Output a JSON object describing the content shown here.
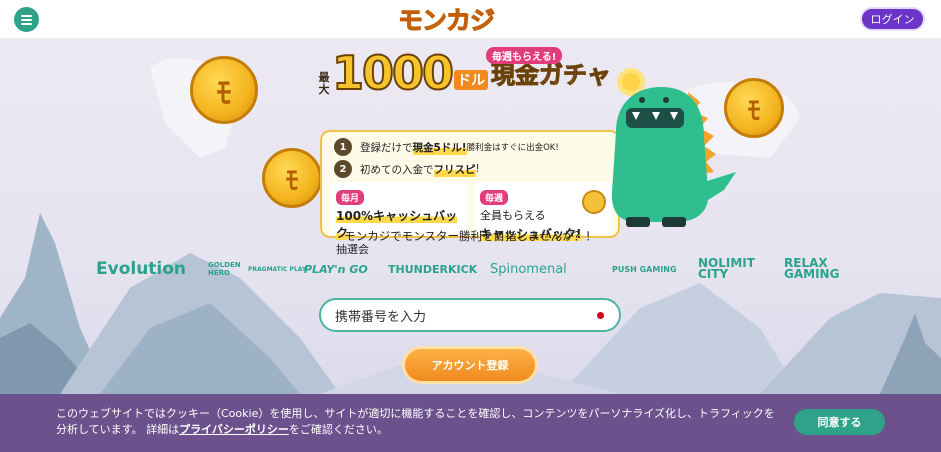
{
  "header": {
    "logo_text": "モンカジ",
    "login_label": "ログイン",
    "menu_icon": "hamburger-menu-icon"
  },
  "promo": {
    "max_label": "最大",
    "amount": "1000",
    "currency": "ドル",
    "gacha": "現金ガチャ",
    "weekly_badge": "毎週もらえる!",
    "step1_num": "1",
    "step1_a": "登録だけで",
    "step1_hl": "現金5ドル!",
    "step1_b": "勝利金はすぐに出金OK!",
    "step2_num": "2",
    "step2_a": "初めての入金で",
    "step2_hl": "フリスピ",
    "step2_b": "!",
    "card1_tag": "毎月",
    "card1_l1": "100%キャッシュバック",
    "card1_l2": "抽選会",
    "card2_tag": "毎週",
    "card2_l1": "全員もらえる",
    "card2_l2": "キャッシュバック!"
  },
  "tagline": "モンカジでモンスター勝利を目指しませんか？！",
  "providers": [
    "Evolution",
    "GOLDEN HERO",
    "PRAGMATIC PLAY",
    "PLAY'n GO",
    "THUNDERKICK",
    "Spinomenal",
    "PUSH GAMING",
    "NOLIMIT CITY",
    "RELAX GAMING"
  ],
  "form": {
    "phone_placeholder": "携帯番号を入力",
    "register_label": "アカウント登録"
  },
  "cookie": {
    "text_a": "このウェブサイトではクッキー（Cookie）を使用し、サイトが適切に機能することを確認し、コンテンツをパーソナライズ化し、トラフィックを分析しています。 詳細は",
    "link": "プライバシーポリシー",
    "text_b": "をご確認ください。",
    "agree_label": "同意する"
  },
  "colors": {
    "accent_green": "#2ea38a",
    "accent_purple": "#6b35c9",
    "accent_orange": "#f08a1e",
    "cookie_bg": "#6c518d"
  }
}
